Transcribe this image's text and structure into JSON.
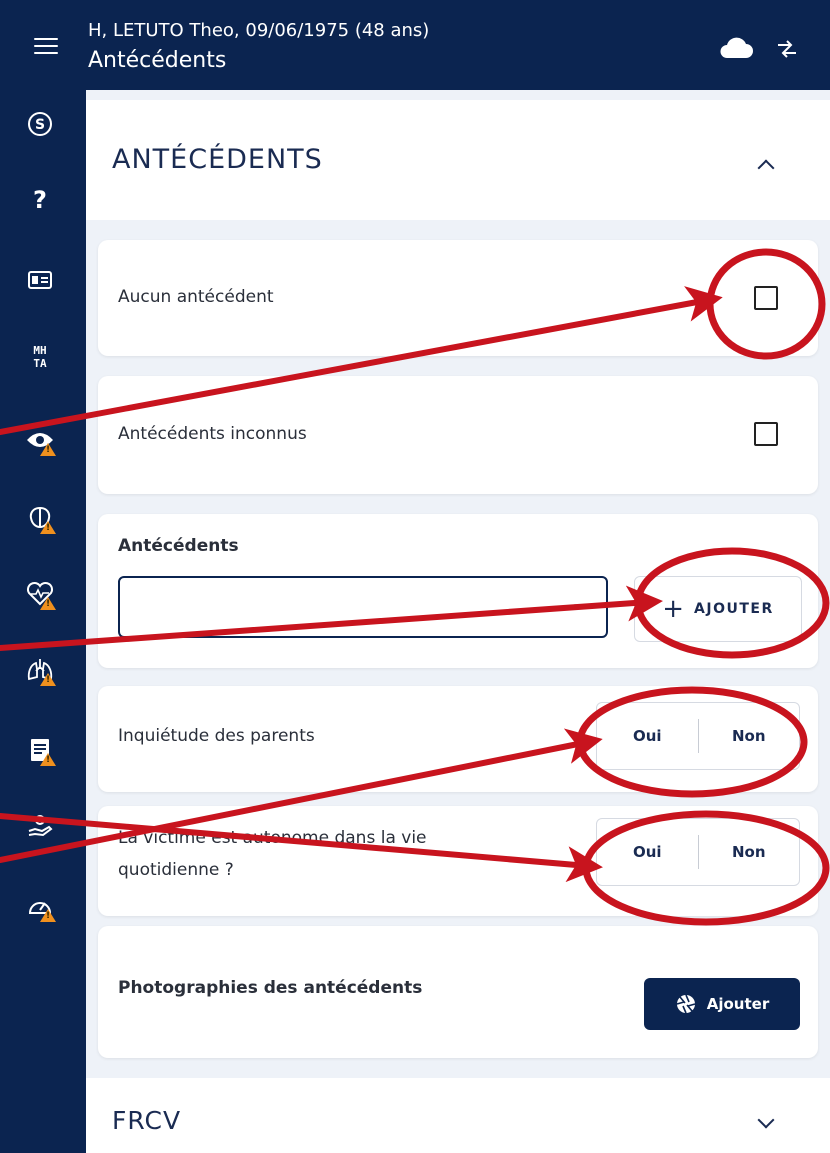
{
  "header": {
    "patient": "H, LETUTO Theo, 09/06/1975 (48 ans)",
    "title": "Antécédents",
    "menu_icon": "hamburger-menu-icon",
    "cloud_icon": "cloud-icon",
    "sync_icon": "sync-icon"
  },
  "sidebar": {
    "items": [
      {
        "icon": "s-circle-icon",
        "warning": false
      },
      {
        "icon": "question-icon",
        "warning": false
      },
      {
        "icon": "id-card-icon",
        "warning": false
      },
      {
        "icon": "mhta-icon",
        "label": "MH\nTA",
        "warning": false
      },
      {
        "icon": "eye-icon",
        "warning": true
      },
      {
        "icon": "brain-icon",
        "warning": true
      },
      {
        "icon": "heart-pulse-icon",
        "warning": true
      },
      {
        "icon": "lungs-icon",
        "warning": true
      },
      {
        "icon": "document-icon",
        "warning": true
      },
      {
        "icon": "hand-care-icon",
        "warning": false
      },
      {
        "icon": "gauge-icon",
        "warning": true
      }
    ]
  },
  "section": {
    "title": "ANTÉCÉDENTS",
    "expanded": true
  },
  "cards": {
    "none": {
      "label": "Aucun antécédent",
      "checked": false
    },
    "unknown": {
      "label": "Antécédents inconnus",
      "checked": false
    },
    "list": {
      "label": "Antécédents",
      "value": "",
      "add_label": "AJOUTER"
    },
    "parents": {
      "label": "Inquiétude des parents",
      "yes": "Oui",
      "no": "Non"
    },
    "autonomy": {
      "label_line1": "La victime est autonome dans la vie",
      "label_line2": "quotidienne ?",
      "yes": "Oui",
      "no": "Non"
    },
    "photos": {
      "label": "Photographies des antécédents",
      "button": "Ajouter"
    }
  },
  "next_section": {
    "title": "FRCV",
    "expanded": false
  },
  "colors": {
    "navy": "#0b2450",
    "background": "#eef2f8",
    "annotation_red": "#c8141e",
    "warning_orange": "#f0901e"
  }
}
